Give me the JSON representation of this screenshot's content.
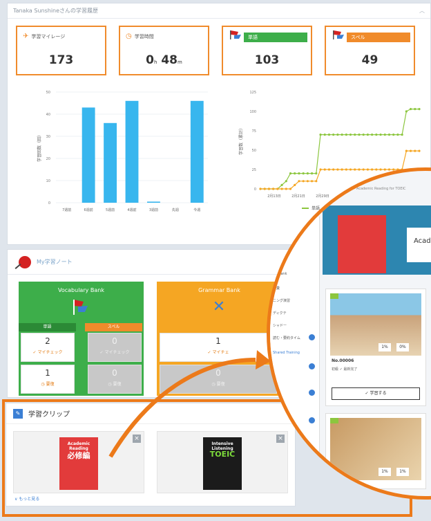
{
  "top_panel": {
    "header": "Tanaka Sunshineさんの学習履歴",
    "stats": [
      {
        "label": "学習マイレージ",
        "value": "173",
        "unit": ""
      },
      {
        "label": "学習時間",
        "value": "0",
        "unit_h": "h",
        "value2": "48",
        "unit_m": "m"
      },
      {
        "label": "単語",
        "value": "103",
        "pill_color": "#3dae4a"
      },
      {
        "label": "スペル",
        "value": "49",
        "pill_color": "#f08b2b"
      }
    ]
  },
  "chart_data": [
    {
      "type": "bar",
      "ylabel": "学習回数（回）",
      "yticks": [
        "0",
        "10",
        "20",
        "30",
        "40",
        "50"
      ],
      "ylim": [
        0,
        50
      ],
      "categories": [
        "7週前",
        "6週前",
        "5週前",
        "4週前",
        "3週前",
        "先週",
        "今週"
      ],
      "values": [
        0,
        43,
        36,
        46,
        0.5,
        0,
        46
      ],
      "color": "#38b6ee"
    },
    {
      "type": "line",
      "ylabel": "学習数（累計）",
      "yticks": [
        "0",
        "25",
        "50",
        "75",
        "100",
        "125"
      ],
      "ylim": [
        0,
        125
      ],
      "xticks": [
        "2月13日",
        "2月21日",
        "2月29日"
      ],
      "legend": [
        "単語"
      ],
      "series": [
        {
          "name": "単語",
          "color": "#8cc63f",
          "values": [
            0,
            0,
            0,
            0,
            0,
            5,
            10,
            20,
            20,
            20,
            20,
            20,
            20,
            20,
            70,
            70,
            70,
            70,
            70,
            70,
            70,
            70,
            70,
            70,
            70,
            70,
            70,
            70,
            70,
            70,
            70,
            70,
            70,
            70,
            100,
            103,
            103,
            103
          ]
        },
        {
          "color": "#f5a623",
          "values": [
            0,
            0,
            0,
            0,
            0,
            0,
            0,
            0,
            5,
            10,
            10,
            10,
            10,
            10,
            25,
            25,
            25,
            25,
            25,
            25,
            25,
            25,
            25,
            25,
            25,
            25,
            25,
            25,
            25,
            25,
            25,
            25,
            25,
            25,
            49,
            49,
            49,
            49
          ]
        }
      ]
    }
  ],
  "note_panel": {
    "title": "My学習ノート",
    "vocab": {
      "title": "Vocabulary Bank",
      "tab1": "単語",
      "tab2": "スペル",
      "cells": [
        {
          "n": "2",
          "s": "✓ マイチェック"
        },
        {
          "n": "0",
          "s": "✓ マイチェック"
        },
        {
          "n": "1",
          "s": "◷ 要復"
        },
        {
          "n": "0",
          "s": "◷ 要復"
        }
      ]
    },
    "grammar": {
      "title": "Grammar Bank",
      "cells": [
        {
          "n": "1",
          "s": "✓ マイチェ"
        },
        {
          "n": "0",
          "s": "◷ 要復"
        }
      ]
    }
  },
  "clip_panel": {
    "title": "学習クリップ",
    "footer": "∨ もっと見る",
    "cards": [
      {
        "title": "Academic Reading",
        "subtitle": "必修編",
        "color": "#e23b3b"
      },
      {
        "title": "Intensive Listening",
        "subtitle": "TOEIC",
        "color": "#1b1b1b"
      }
    ]
  },
  "zoom": {
    "breadcrumb": "2月13日 ng Bank > Academic Reading for TOEIC",
    "banner_label": "Acade",
    "sidebar": [
      "ng Bank",
      "語彙",
      "ニング演習",
      "ディクテ",
      "シャドー",
      "読む・要約タイム",
      "Shared Training"
    ],
    "cards": [
      {
        "no": "No.00006",
        "sub": "初級 ✓ 最新完了",
        "button": "✓ 学習する",
        "badge1": "1%",
        "badge2": "0%"
      },
      {
        "no": "",
        "sub": "",
        "button": "",
        "badge1": "1%",
        "badge2": "1%"
      }
    ]
  }
}
